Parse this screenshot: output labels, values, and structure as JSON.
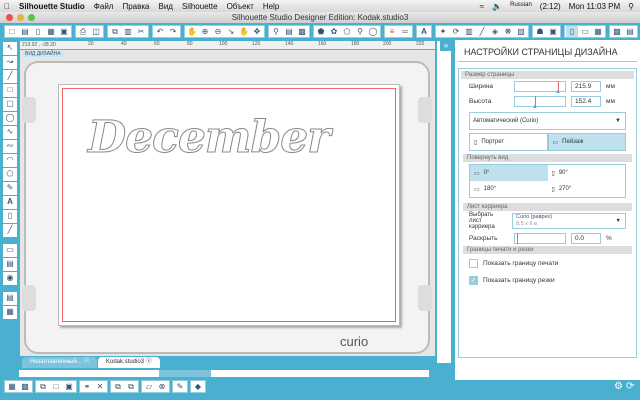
{
  "menubar": {
    "app": "Silhouette Studio",
    "items": [
      "Файл",
      "Правка",
      "Вид",
      "Silhouette",
      "Объект",
      "Help"
    ],
    "status": {
      "language": "Russian",
      "battery": "(2:12)",
      "clock": "Mon 11:03 PM"
    }
  },
  "window": {
    "title": "Silhouette Studio Designer Edition: Kodak.studio3"
  },
  "ruler": {
    "coords": "213.92 , -28.20",
    "ticks": [
      "20",
      "40",
      "60",
      "80",
      "100",
      "120",
      "140",
      "160",
      "180",
      "200",
      "220"
    ]
  },
  "canvas": {
    "view_label": "ВИД ДИЗАЙНА",
    "design_text": "December",
    "mat_brand": "curio"
  },
  "tabs": [
    {
      "label": "Незаглавленный...",
      "active": false
    },
    {
      "label": "Kodak.studio3",
      "active": true
    }
  ],
  "panel": {
    "title": "НАСТРОЙКИ СТРАНИЦЫ ДИЗАЙНА",
    "page_size": {
      "header": "Размер страницы",
      "width_label": "Ширина",
      "width_value": "215.9",
      "height_label": "Высота",
      "height_value": "152.4",
      "unit": "мм",
      "width_slider": 0.85,
      "height_slider": 0.38,
      "preset": "Автоматический (Curio)",
      "portrait": "Портрет",
      "landscape": "Пейзаж"
    },
    "rotate": {
      "header": "Повернуть вид",
      "options": [
        "0°",
        "90°",
        "180°",
        "270°"
      ],
      "selected": "0°"
    },
    "carrier": {
      "header": "Лист кэрриера",
      "select_label": "Выбрать лист кэрриера",
      "select_value": "Curio (раврех)",
      "select_sub": "8,5 x 6 в",
      "expand_label": "Раскрыть",
      "expand_value": "0.0",
      "expand_unit": "%"
    },
    "borders": {
      "header": "Границы печати и резки",
      "show_print": "Показать границу печати",
      "show_print_checked": false,
      "show_cut": "Показать границу резки",
      "show_cut_checked": true
    }
  },
  "colors": {
    "accent": "#4ab0d0",
    "selected": "#bfe1ee",
    "cutline": "#e66666"
  }
}
